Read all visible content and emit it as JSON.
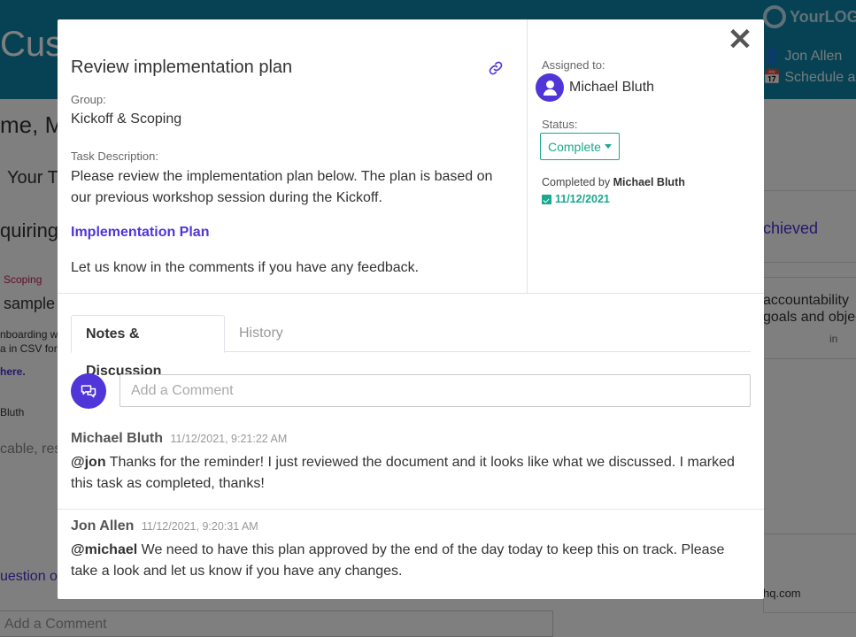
{
  "background": {
    "title": "Cus",
    "logo_text": "YourLOG",
    "user_name": "Jon Allen",
    "schedule_text": "Schedule a m",
    "welcome": "me, Mi",
    "your_tasks": "Your T",
    "requiring": "quiring",
    "scoping": "Scoping",
    "sample": "sample",
    "onboarding_line1": "nboarding w",
    "onboarding_line2": "a in CSV form",
    "here_link": "here.",
    "bluth": "Bluth",
    "cable": "cable, res",
    "question": "uestion o",
    "add_comment": "Add a Comment",
    "achieved": "chieved",
    "accountability_line1": "accountability",
    "accountability_line2": "goals and objec",
    "in_label": "in",
    "email_fragment": "hq.com"
  },
  "modal": {
    "title": "Review implementation plan",
    "group_label": "Group:",
    "group_value": "Kickoff & Scoping",
    "desc_label": "Task Description:",
    "desc_text": "Please review the implementation plan below. The plan is based on our previous workshop session during the Kickoff.",
    "impl_link": "Implementation Plan",
    "feedback": "Let us know in the comments if you have any feedback.",
    "assigned_label": "Assigned to:",
    "assignee": "Michael Bluth",
    "status_label": "Status:",
    "status_value": "Complete",
    "completed_by_prefix": "Completed by",
    "completed_by_name": "Michael Bluth",
    "completed_date": "11/12/2021",
    "close_glyph": "✕"
  },
  "tabs": {
    "notes": "Notes & Discussion",
    "history": "History"
  },
  "comment_box": {
    "placeholder": "Add a Comment"
  },
  "comments": [
    {
      "author": "Michael Bluth",
      "time": "11/12/2021, 9:21:22 AM",
      "mention": "@jon",
      "text": " Thanks for the reminder! I just reviewed the document and it looks like what we discussed. I marked this task as completed, thanks!"
    },
    {
      "author": "Jon Allen",
      "time": "11/12/2021, 9:20:31 AM",
      "mention": "@michael",
      "text": " We need to have this plan approved by the end of the day today to keep this on track. Please take a look and let us know if you have any changes."
    }
  ],
  "colors": {
    "header": "#0e84a8",
    "accent": "#5035d9",
    "status": "#1aa88f"
  },
  "icons": [
    "link-icon",
    "close-icon",
    "user-icon",
    "caret-down-icon",
    "calendar-check-icon",
    "chat-icon"
  ]
}
